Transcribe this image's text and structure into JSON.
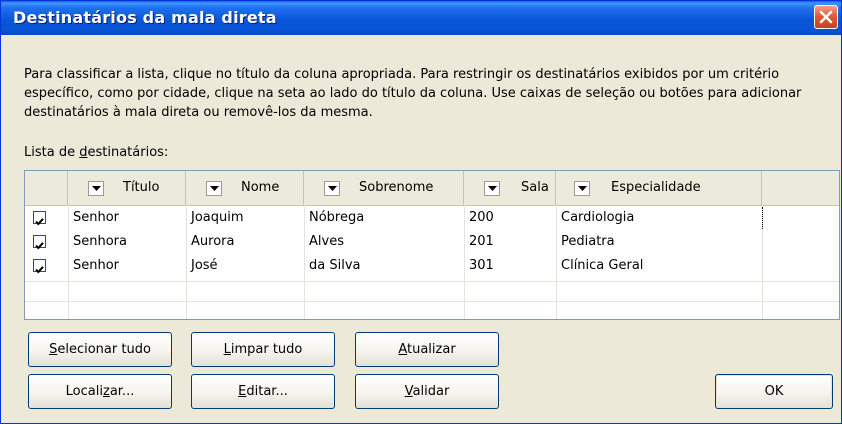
{
  "window": {
    "title": "Destinatários da mala direta"
  },
  "description": "Para classificar a lista, clique no título da coluna apropriada. Para restringir os destinatários exibidos por um critério específico, como por cidade, clique na seta ao lado do título da coluna. Use caixas de seleção ou botões para adicionar destinatários à mala direta ou removê-los da mesma.",
  "list_label": {
    "pre": "Lista de ",
    "accel": "d",
    "post": "estinatários:"
  },
  "columns": [
    "Título",
    "Nome",
    "Sobrenome",
    "Sala",
    "Especialidade"
  ],
  "rows": [
    {
      "checked": true,
      "titulo": "Senhor",
      "nome": "Joaquim",
      "sobrenome": "Nóbrega",
      "sala": "200",
      "especialidade": "Cardiologia"
    },
    {
      "checked": true,
      "titulo": "Senhora",
      "nome": "Aurora",
      "sobrenome": "Alves",
      "sala": "201",
      "especialidade": "Pediatra"
    },
    {
      "checked": true,
      "titulo": "Senhor",
      "nome": "José",
      "sobrenome": "da Silva",
      "sala": "301",
      "especialidade": "Clínica Geral"
    }
  ],
  "buttons": {
    "select_all": {
      "pre": "",
      "accel": "S",
      "post": "elecionar tudo"
    },
    "clear_all": {
      "pre": "",
      "accel": "L",
      "post": "impar tudo"
    },
    "refresh": {
      "pre": "",
      "accel": "A",
      "post": "tualizar"
    },
    "find": {
      "pre": "Locali",
      "accel": "z",
      "post": "ar..."
    },
    "edit": {
      "pre": "",
      "accel": "E",
      "post": "ditar..."
    },
    "validate": {
      "pre": "",
      "accel": "V",
      "post": "alidar"
    },
    "ok": "OK"
  },
  "colors": {
    "titlebar": "#0a56d8",
    "dialog_bg": "#ece9d8",
    "close_button": "#e2593a",
    "list_border": "#7f9db9"
  }
}
